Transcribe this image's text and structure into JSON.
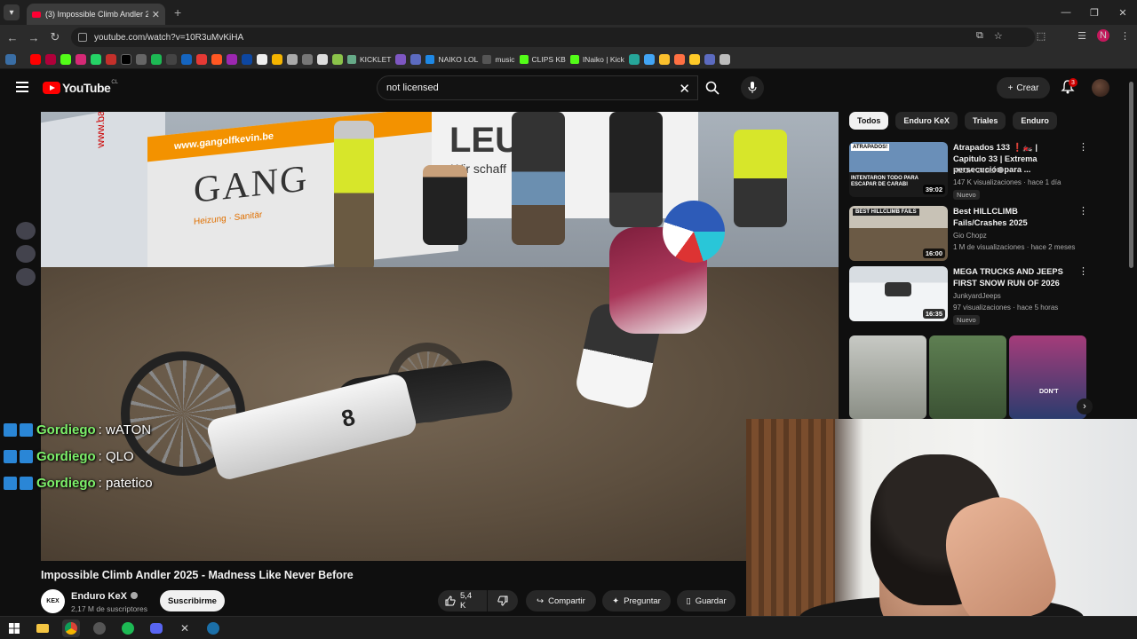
{
  "browser": {
    "tab_title": "(3) Impossible Climb Andler 2025",
    "url": "youtube.com/watch?v=10R3uMvKiHA",
    "profile_initial": "N",
    "bookmarks": [
      "KICKLET",
      "NAIKO LOL",
      "music",
      "CLIPS KB",
      "INaiko | Kick"
    ]
  },
  "masthead": {
    "logo_text": "YouTube",
    "region": "CL",
    "search_value": "not licensed",
    "create_label": "Crear",
    "notification_count": "3"
  },
  "video": {
    "board_text_1": "www.gangolfkevin.be",
    "board_text_2": "GANG",
    "board_text_3": "Heizung · Sanitär",
    "board_text_4": "LEU",
    "board_text_5": "Wir schaff",
    "board_text_6": "www.baures.be",
    "bike_number": "8",
    "chat": [
      {
        "user": "Gordiego",
        "msg": ": wATON"
      },
      {
        "user": "Gordiego",
        "msg": ": QLO"
      },
      {
        "user": "Gordiego",
        "msg": ": patetico"
      }
    ]
  },
  "info": {
    "title": "Impossible Climb Andler 2025 - Madness Like Never Before",
    "channel": "Enduro KeX",
    "subscribers": "2,17 M de suscriptores",
    "subscribe_label": "Suscribirme",
    "likes": "5,4 K",
    "share_label": "Compartir",
    "ask_label": "Preguntar",
    "save_label": "Guardar"
  },
  "sidebar": {
    "chips": [
      "Todos",
      "Enduro KeX",
      "Triales",
      "Enduro"
    ],
    "recommendations": [
      {
        "title": "Atrapados 133 ❗🏍️ | Capitulo 33 | Extrema persecución para ...",
        "channel": "MEGA Oficial",
        "meta": "147 K visualizaciones · hace 1 día",
        "duration": "39:02",
        "badge": "Nuevo",
        "thumb_text": "INTENTARON TODO PARA ESCAPAR DE CARABI"
      },
      {
        "title": "Best HILLCLIMB Fails/Crashes 2025",
        "channel": "Gio Chopz",
        "meta": "1 M de visualizaciones · hace 2 meses",
        "duration": "16:00",
        "badge": "",
        "thumb_text": "BEST HILLCLIMB FAILS"
      },
      {
        "title": "MEGA TRUCKS AND JEEPS FIRST SNOW RUN OF 2026",
        "channel": "JunkyardJeeps",
        "meta": "97 visualizaciones · hace 5 horas",
        "duration": "16:35",
        "badge": "Nuevo",
        "thumb_text": ""
      }
    ],
    "short_text": "DON'T"
  },
  "colors": {
    "accent": "#ff0000",
    "chat_user": "#7cf06a"
  }
}
